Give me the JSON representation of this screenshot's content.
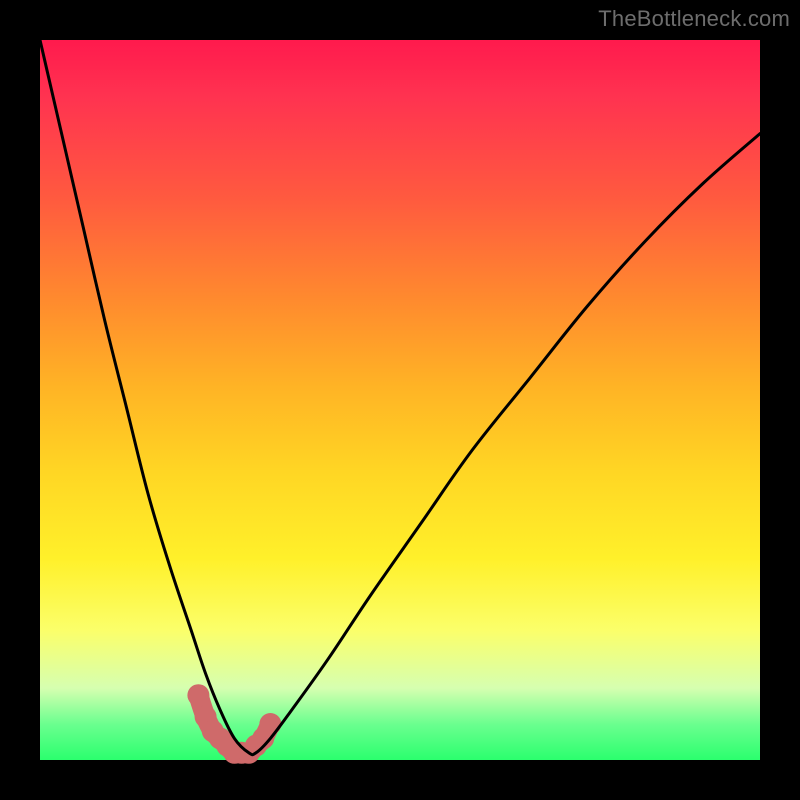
{
  "watermark": "TheBottleneck.com",
  "chart_data": {
    "type": "line",
    "title": "",
    "xlabel": "",
    "ylabel": "",
    "xlim": [
      0,
      100
    ],
    "ylim": [
      0,
      100
    ],
    "series": [
      {
        "name": "bottleneck-curve",
        "x": [
          0,
          3,
          6,
          9,
          12,
          15,
          18,
          21,
          23,
          25,
          27,
          29,
          30,
          32,
          35,
          40,
          46,
          53,
          60,
          68,
          76,
          84,
          92,
          100
        ],
        "values": [
          100,
          87,
          74,
          61,
          49,
          37,
          27,
          18,
          12,
          7,
          3,
          1,
          1,
          3,
          7,
          14,
          23,
          33,
          43,
          53,
          63,
          72,
          80,
          87
        ]
      },
      {
        "name": "marker-band",
        "x": [
          22,
          23,
          24,
          25,
          26,
          27,
          28,
          29,
          30,
          31,
          32
        ],
        "values": [
          9,
          6,
          4,
          3,
          2,
          1,
          1,
          1,
          2,
          3,
          5
        ]
      }
    ],
    "colors": {
      "curve": "#000000",
      "marker": "#cf6a6a"
    }
  }
}
